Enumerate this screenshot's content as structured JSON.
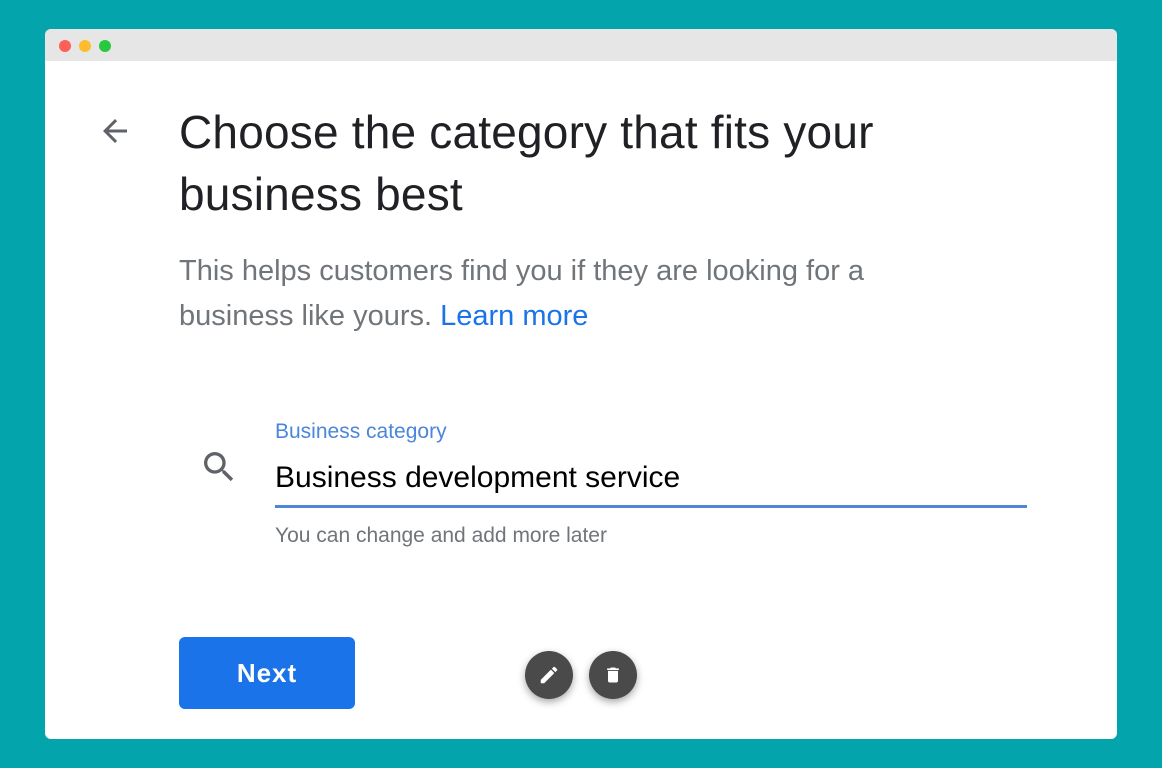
{
  "page": {
    "title": "Choose the category that fits your business best",
    "subtitle": "This helps customers find you if they are looking for a business like yours.",
    "learn_more": "Learn more"
  },
  "field": {
    "label": "Business category",
    "value": "Business development service",
    "helper": "You can change and add more later"
  },
  "actions": {
    "next_label": "Next"
  },
  "icons": {
    "back": "arrow-back-icon",
    "search": "search-icon",
    "edit": "pencil-icon",
    "delete": "trash-icon"
  },
  "colors": {
    "background": "#03a4ac",
    "accent": "#1a73e8"
  }
}
